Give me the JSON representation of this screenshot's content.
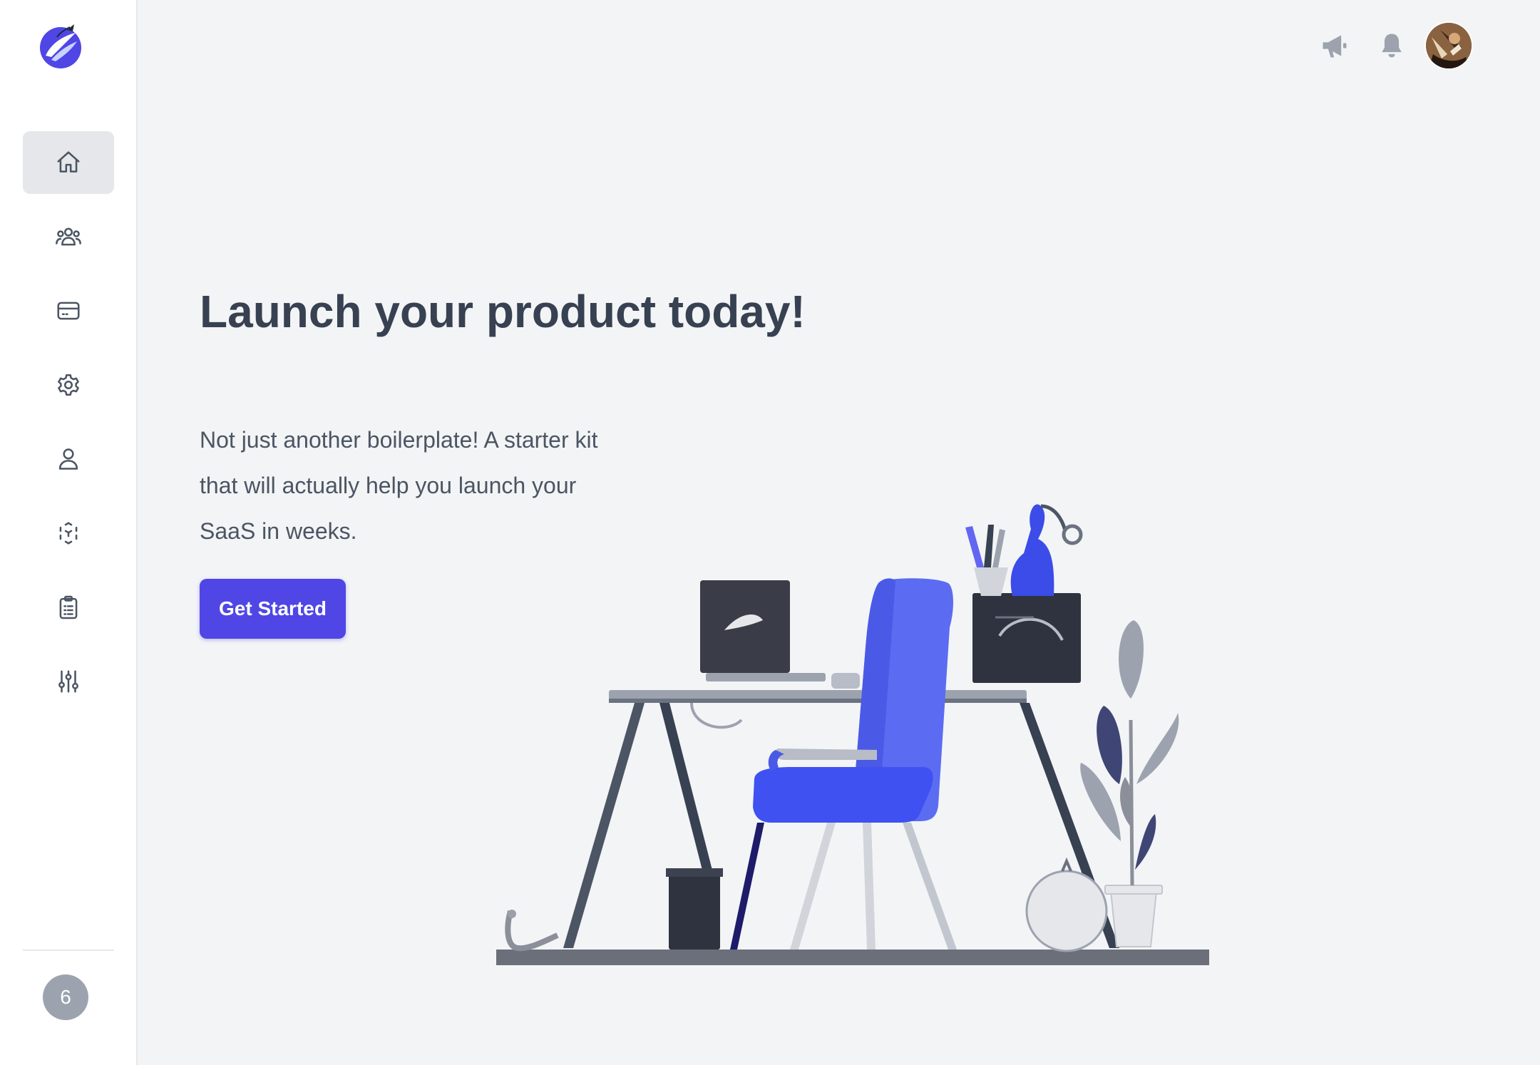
{
  "sidebar": {
    "logo": "app-logo",
    "items": [
      {
        "name": "home",
        "icon": "home-icon",
        "active": true
      },
      {
        "name": "team",
        "icon": "users-icon",
        "active": false
      },
      {
        "name": "billing",
        "icon": "credit-card-icon",
        "active": false
      },
      {
        "name": "settings",
        "icon": "gear-icon",
        "active": false
      },
      {
        "name": "profile",
        "icon": "user-icon",
        "active": false
      },
      {
        "name": "scan",
        "icon": "focus-scan-icon",
        "active": false
      },
      {
        "name": "tasks",
        "icon": "clipboard-icon",
        "active": false
      },
      {
        "name": "adjustments",
        "icon": "sliders-icon",
        "active": false
      }
    ],
    "badge_count": "6"
  },
  "header": {
    "announcements_icon": "megaphone-icon",
    "notifications_icon": "bell-icon",
    "avatar": "user-avatar"
  },
  "hero": {
    "title": "Launch your product today!",
    "description": "Not just another boilerplate! A starter kit that will actually help you launch your SaaS in weeks.",
    "cta_label": "Get Started"
  },
  "colors": {
    "accent": "#4f46e5",
    "background": "#f3f4f6",
    "sidebar_bg": "#ffffff",
    "active_nav_bg": "#e5e7eb",
    "title_text": "#374151",
    "body_text": "#4b5563"
  }
}
